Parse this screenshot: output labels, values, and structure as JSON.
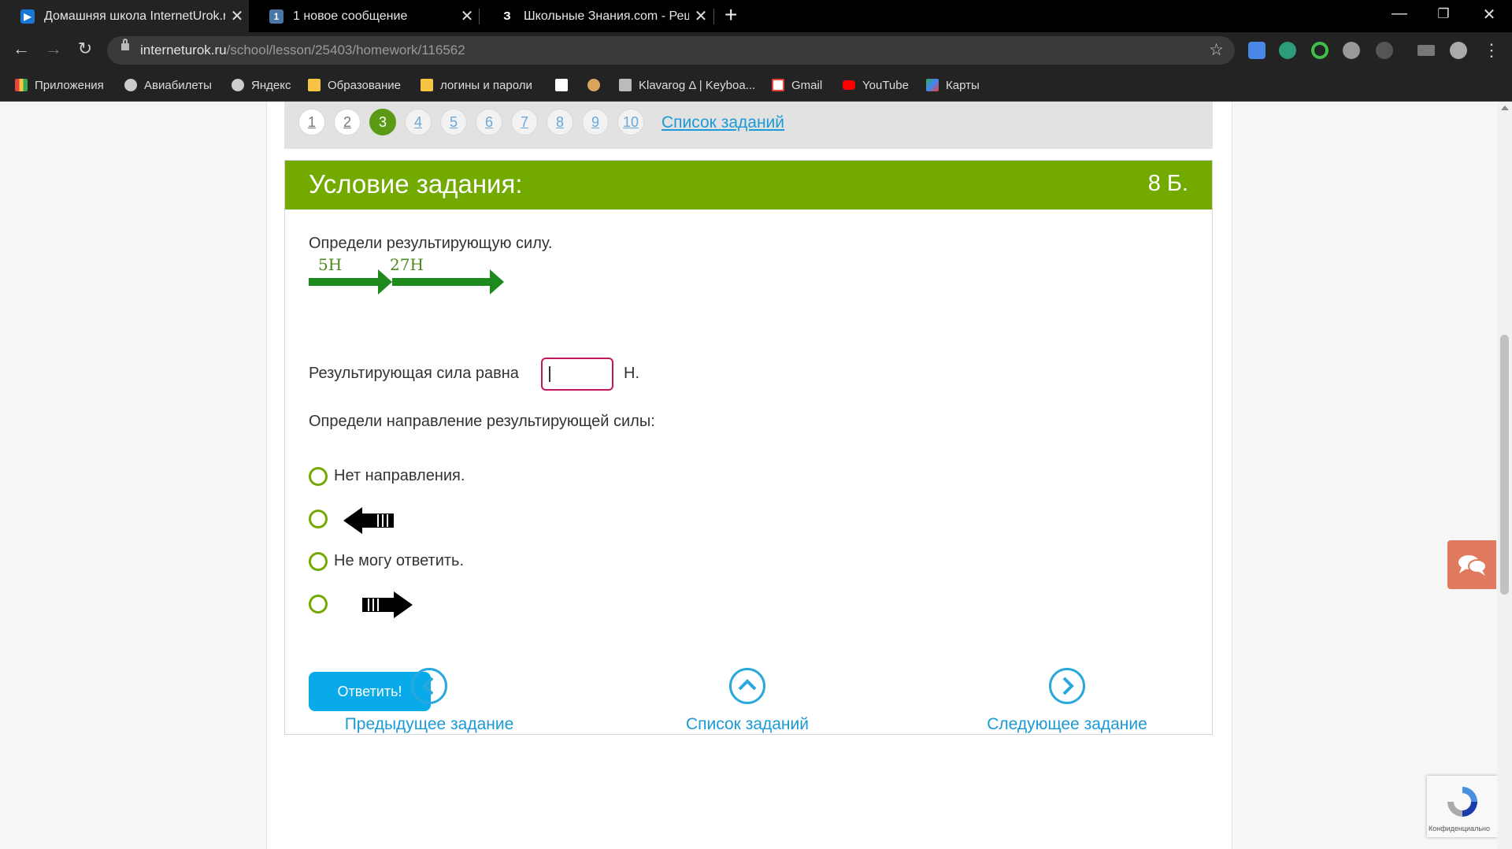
{
  "browser": {
    "tabs": [
      {
        "title": "Домашняя школа InternetUrok.r",
        "favicon": "play-icon",
        "active": true
      },
      {
        "title": "1 новое сообщение",
        "favicon": "vk-icon",
        "badge": "1"
      },
      {
        "title": "Школьные Знания.com - Решаю",
        "favicon": "znanija-icon",
        "badge": "З"
      }
    ],
    "url_host": "interneturok.ru",
    "url_path": "/school/lesson/25403/homework/116562",
    "bookmarks": [
      {
        "label": "Приложения",
        "icon": "apps-icon",
        "color": "#e8453c"
      },
      {
        "label": "Авиабилеты",
        "icon": "globe-icon",
        "color": "#cccccc"
      },
      {
        "label": "Яндекс",
        "icon": "globe-icon",
        "color": "#cccccc"
      },
      {
        "label": "Образование",
        "icon": "folder-icon",
        "color": "#f6c343"
      },
      {
        "label": "логины и пароли",
        "icon": "folder-icon",
        "color": "#f6c343"
      },
      {
        "label": "",
        "icon": "egov-icon",
        "color": "#ffffff"
      },
      {
        "label": "",
        "icon": "gear-favicon-icon",
        "color": "#d8a55a"
      },
      {
        "label": "Klavarog Δ | Keyboa...",
        "icon": "keyboard-icon",
        "color": "#bbbbbb"
      },
      {
        "label": "Gmail",
        "icon": "gmail-icon",
        "color": "#ea4335"
      },
      {
        "label": "YouTube",
        "icon": "youtube-icon",
        "color": "#ff0000"
      },
      {
        "label": "Карты",
        "icon": "maps-icon",
        "color": "#34a853"
      }
    ]
  },
  "pager": {
    "pages": [
      "1",
      "2",
      "3",
      "4",
      "5",
      "6",
      "7",
      "8",
      "9",
      "10"
    ],
    "current": "3",
    "task_list_link": "Список заданий"
  },
  "task": {
    "header": "Условие задания:",
    "points": "8 Б.",
    "question": "Определи результирующую силу.",
    "force1": "5Н",
    "force2": "27Н",
    "answer_label": "Результирующая сила равна",
    "answer_value": "",
    "answer_unit": "Н.",
    "direction_question": "Определи направление результирующей силы:",
    "options": [
      {
        "text": "Нет направления.",
        "type": "text"
      },
      {
        "text": "",
        "type": "arrow-left-icon"
      },
      {
        "text": "Не могу ответить.",
        "type": "text"
      },
      {
        "text": "",
        "type": "arrow-right-icon"
      }
    ],
    "submit": "Ответить!"
  },
  "navigation": {
    "prev": "Предыдущее задание",
    "list": "Список заданий",
    "next": "Следующее задание"
  },
  "recaptcha": {
    "label": "Конфиденциально"
  },
  "colors": {
    "accent_green": "#72aa00",
    "arrow_green": "#1e8a1e",
    "link_blue": "#1c9ad6",
    "button_blue": "#08aaea",
    "chat_button": "#e07a5f"
  }
}
